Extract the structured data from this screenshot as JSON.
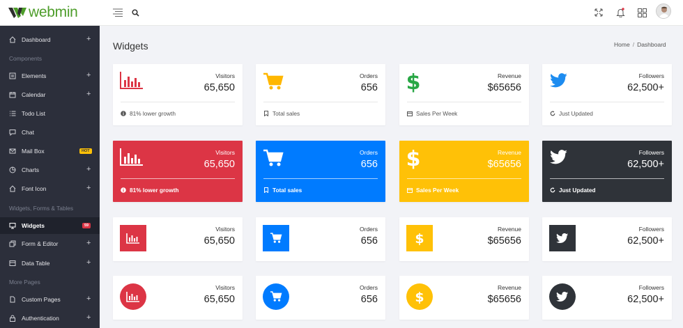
{
  "app": {
    "logo_text": "webmin"
  },
  "sidebar": {
    "items": [
      {
        "label": "Dashboard",
        "has_plus": true
      },
      {
        "label": "Elements",
        "has_plus": true
      },
      {
        "label": "Calendar",
        "has_plus": true
      },
      {
        "label": "Todo List",
        "has_plus": false
      },
      {
        "label": "Chat",
        "has_plus": false
      },
      {
        "label": "Mail Box",
        "badge": "HOT"
      },
      {
        "label": "Charts",
        "has_plus": true
      },
      {
        "label": "Font Icon",
        "has_plus": true
      },
      {
        "label": "Widgets",
        "badge": "59",
        "active": true
      },
      {
        "label": "Form & Editor",
        "has_plus": true
      },
      {
        "label": "Data Table",
        "has_plus": true
      },
      {
        "label": "Custom Pages",
        "has_plus": true
      },
      {
        "label": "Authentication",
        "has_plus": true
      }
    ],
    "headers": [
      "Components",
      "Widgets, Forms & Tables",
      "More Pages"
    ],
    "plus_symbol": "+"
  },
  "page": {
    "title": "Widgets",
    "breadcrumb": [
      "Home",
      "Dashboard"
    ],
    "breadcrumb_sep": "/"
  },
  "widgets": {
    "visitors": {
      "title": "Visitors",
      "value": "65,650",
      "foot": "81% lower growth",
      "color": "#dc3545"
    },
    "orders": {
      "title": "Orders",
      "value": "656",
      "foot": "Total sales",
      "color": "#007bff"
    },
    "revenue": {
      "title": "Revenue",
      "value": "$65656",
      "foot": "Sales Per Week",
      "color": "#ffc107"
    },
    "followers": {
      "title": "Followers",
      "value": "62,500+",
      "foot": "Just Updated",
      "color": "#2f3339"
    }
  },
  "colors": {
    "icon_outline_orders": "#ffb700",
    "icon_outline_revenue": "#28a745",
    "icon_outline_twitter": "#1d8cf0",
    "sidebar_bg": "#2c2f3b"
  }
}
